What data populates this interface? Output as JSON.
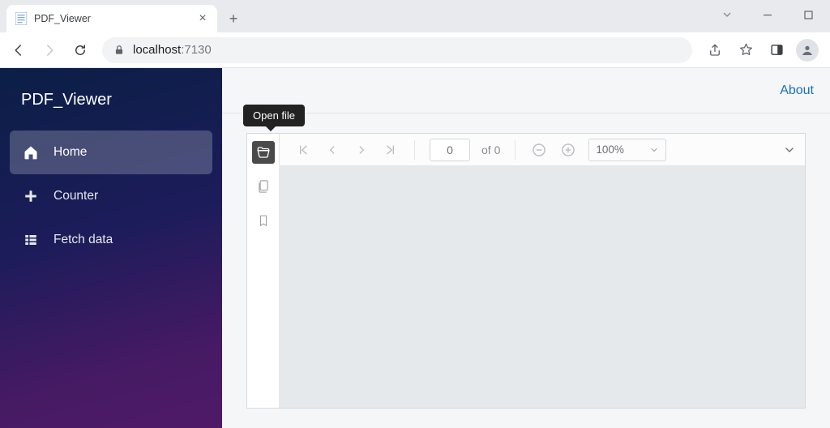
{
  "browser": {
    "tab_title": "PDF_Viewer",
    "url_host": "localhost",
    "url_port": ":7130"
  },
  "app": {
    "brand": "PDF_Viewer",
    "nav": {
      "home": "Home",
      "counter": "Counter",
      "fetch": "Fetch data"
    },
    "about": "About"
  },
  "pdf": {
    "tooltip_open": "Open file",
    "page_value": "0",
    "page_of": "of 0",
    "zoom_value": "100%"
  }
}
